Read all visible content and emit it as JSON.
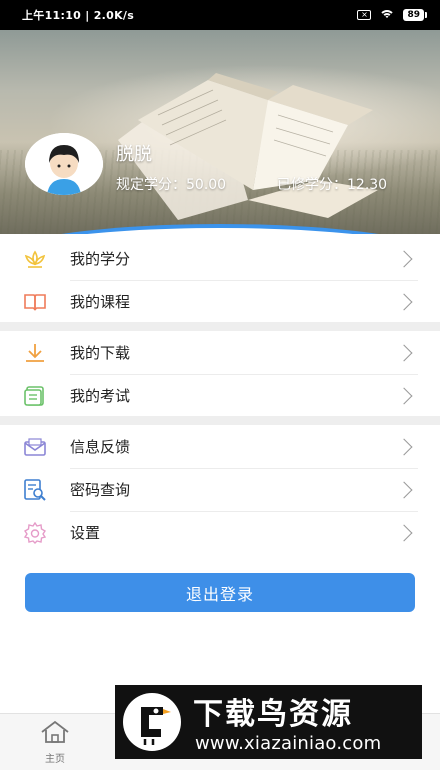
{
  "status_bar": {
    "time_speed": "上午11:10 | 2.0K/s",
    "battery": "89"
  },
  "profile": {
    "name": "脱脱",
    "required_credits": "规定学分：50.00",
    "earned_credits": "已修学分：12.30"
  },
  "menu": {
    "group1": [
      {
        "label": "我的学分",
        "icon": "lotus-icon",
        "color": "#f2c33c"
      },
      {
        "label": "我的课程",
        "icon": "book-icon",
        "color": "#ef7b5a"
      }
    ],
    "group2": [
      {
        "label": "我的下载",
        "icon": "download-icon",
        "color": "#f0a040"
      },
      {
        "label": "我的考试",
        "icon": "exam-icon",
        "color": "#6cc26a"
      }
    ],
    "group3": [
      {
        "label": "信息反馈",
        "icon": "mail-icon",
        "color": "#8b86d6"
      },
      {
        "label": "密码查询",
        "icon": "search-doc-icon",
        "color": "#3e7fd0"
      },
      {
        "label": "设置",
        "icon": "gear-icon",
        "color": "#e59bc8"
      }
    ]
  },
  "logout_label": "退出登录",
  "tab_bar": {
    "home_label": "主页"
  },
  "watermark": {
    "title": "下载鸟资源",
    "url": "www.xiazainiao.com"
  },
  "colors": {
    "accent": "#3e8fe8"
  }
}
